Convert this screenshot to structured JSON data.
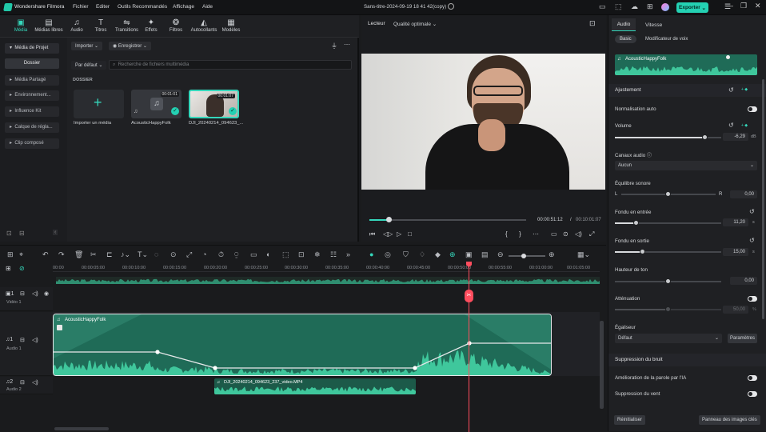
{
  "app": {
    "name": "Wondershare Filmora",
    "project_title": "Sans-titre-2024-09-19 18 41 42(copy)",
    "export_label": "Exporter"
  },
  "menu": [
    "Fichier",
    "Editer",
    "Outils Recommandés",
    "Affichage",
    "Aide"
  ],
  "media_tabs": [
    {
      "label": "Média",
      "icon": "media-icon",
      "active": true
    },
    {
      "label": "Médias libres",
      "icon": "stock-media-icon"
    },
    {
      "label": "Audio",
      "icon": "music-note-icon"
    },
    {
      "label": "Titres",
      "icon": "text-icon"
    },
    {
      "label": "Transitions",
      "icon": "transitions-icon"
    },
    {
      "label": "Effets",
      "icon": "effects-icon"
    },
    {
      "label": "Filtres",
      "icon": "filters-icon"
    },
    {
      "label": "Autocollants",
      "icon": "stickers-icon"
    },
    {
      "label": "Modèles",
      "icon": "templates-icon"
    }
  ],
  "sidebar": {
    "items": [
      "Média de Projet",
      "Dossier",
      "Média Partagé",
      "Environnement...",
      "Influence Kit",
      "Calque de régla...",
      "Clip composé"
    ]
  },
  "media_toolbar": {
    "import_label": "Importer",
    "record_label": "Enregistrer",
    "sort_label": "Par défaut",
    "search_placeholder": "Recherche de fichiers multimédia"
  },
  "folder_label": "DOSSIER",
  "media_items": [
    {
      "name": "Importer un média",
      "type": "import"
    },
    {
      "name": "AcousticHappyFolk",
      "type": "audio",
      "duration": "00:01:01"
    },
    {
      "name": "DJI_20240214_094623_...",
      "type": "video",
      "duration": "00:01:07"
    }
  ],
  "player": {
    "tab": "Lecteur",
    "quality": "Qualité optimale",
    "current_time": "00:00:51:12",
    "total_time": "00:10:01:07",
    "progress": 0.12
  },
  "right_panel": {
    "tabs": [
      "Audio",
      "Vitesse"
    ],
    "subtabs": [
      "Basic",
      "Modificateur de voix"
    ],
    "clip_name": "AcousticHappyFolk",
    "adjust_title": "Ajustement",
    "normalization": "Normalisation auto",
    "volume": {
      "label": "Volume",
      "value": "-6,29",
      "unit": "dB",
      "level": 0.85
    },
    "channels": {
      "label": "Canaux audio",
      "value": "Aucun"
    },
    "balance": {
      "label": "Équilibre sonore",
      "left": "L",
      "right": "R",
      "value": "0,00",
      "level": 0.5
    },
    "fade_in": {
      "label": "Fondu en entrée",
      "value": "11,20",
      "unit": "s",
      "level": 0.2
    },
    "fade_out": {
      "label": "Fondu en sortie",
      "value": "15,00",
      "unit": "s",
      "level": 0.26
    },
    "pitch": {
      "label": "Hauteur de ton",
      "value": "0,00",
      "level": 0.5
    },
    "attenuation": {
      "label": "Atténuation",
      "value": "50,00",
      "unit": "%",
      "level": 0.5
    },
    "equalizer": {
      "label": "Égaliseur",
      "value": "Défaut",
      "button": "Paramètres"
    },
    "noise_title": "Suppression du bruit",
    "speech_enhance": "Amélioration de la parole par l'IA",
    "wind_removal": "Suppression du vent",
    "reset_label": "Réinitialiser",
    "keyframe_label": "Panneau des images clés"
  },
  "timeline": {
    "ruler": [
      "00:00",
      "00:00:05:00",
      "00:00:10:00",
      "00:00:15:00",
      "00:00:20:00",
      "00:00:25:00",
      "00:00:30:00",
      "00:00:35:00",
      "00:00:40:00",
      "00:00:45:00",
      "00:00:50:00",
      "00:00:55:00",
      "00:01:00:00",
      "00:01:05:00"
    ],
    "tracks": [
      {
        "num": "1",
        "name": "Vidéo 1"
      },
      {
        "num": "1",
        "name": "Audio 1"
      },
      {
        "num": "2",
        "name": "Audio 2"
      }
    ],
    "audio_clip_1": "AcousticHappyFolk",
    "audio_clip_2": "DJI_20240214_094623_237_video.MP4"
  },
  "colors": {
    "accent": "#24d1b3",
    "playhead": "#ff4d5e",
    "audio_clip": "#1f6b57",
    "waveform": "#3fc79c"
  }
}
